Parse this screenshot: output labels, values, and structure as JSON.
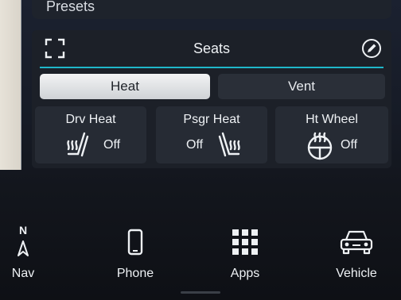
{
  "presets": {
    "label": "Presets"
  },
  "seats": {
    "title": "Seats",
    "tabs": [
      {
        "label": "Heat",
        "selected": true
      },
      {
        "label": "Vent",
        "selected": false
      }
    ],
    "controls": [
      {
        "label": "Drv Heat",
        "status": "Off",
        "icon": "driver-seat-heat-icon"
      },
      {
        "label": "Psgr Heat",
        "status": "Off",
        "icon": "passenger-seat-heat-icon"
      },
      {
        "label": "Ht Wheel",
        "status": "Off",
        "icon": "heated-steering-wheel-icon"
      }
    ]
  },
  "dock": {
    "nav": {
      "label": "Nav",
      "compass": "N"
    },
    "phone": {
      "label": "Phone"
    },
    "apps": {
      "label": "Apps"
    },
    "vehicle": {
      "label": "Vehicle"
    }
  },
  "colors": {
    "accent": "#1fb6c9",
    "panel": "#1c2028",
    "tile": "#262b34"
  }
}
